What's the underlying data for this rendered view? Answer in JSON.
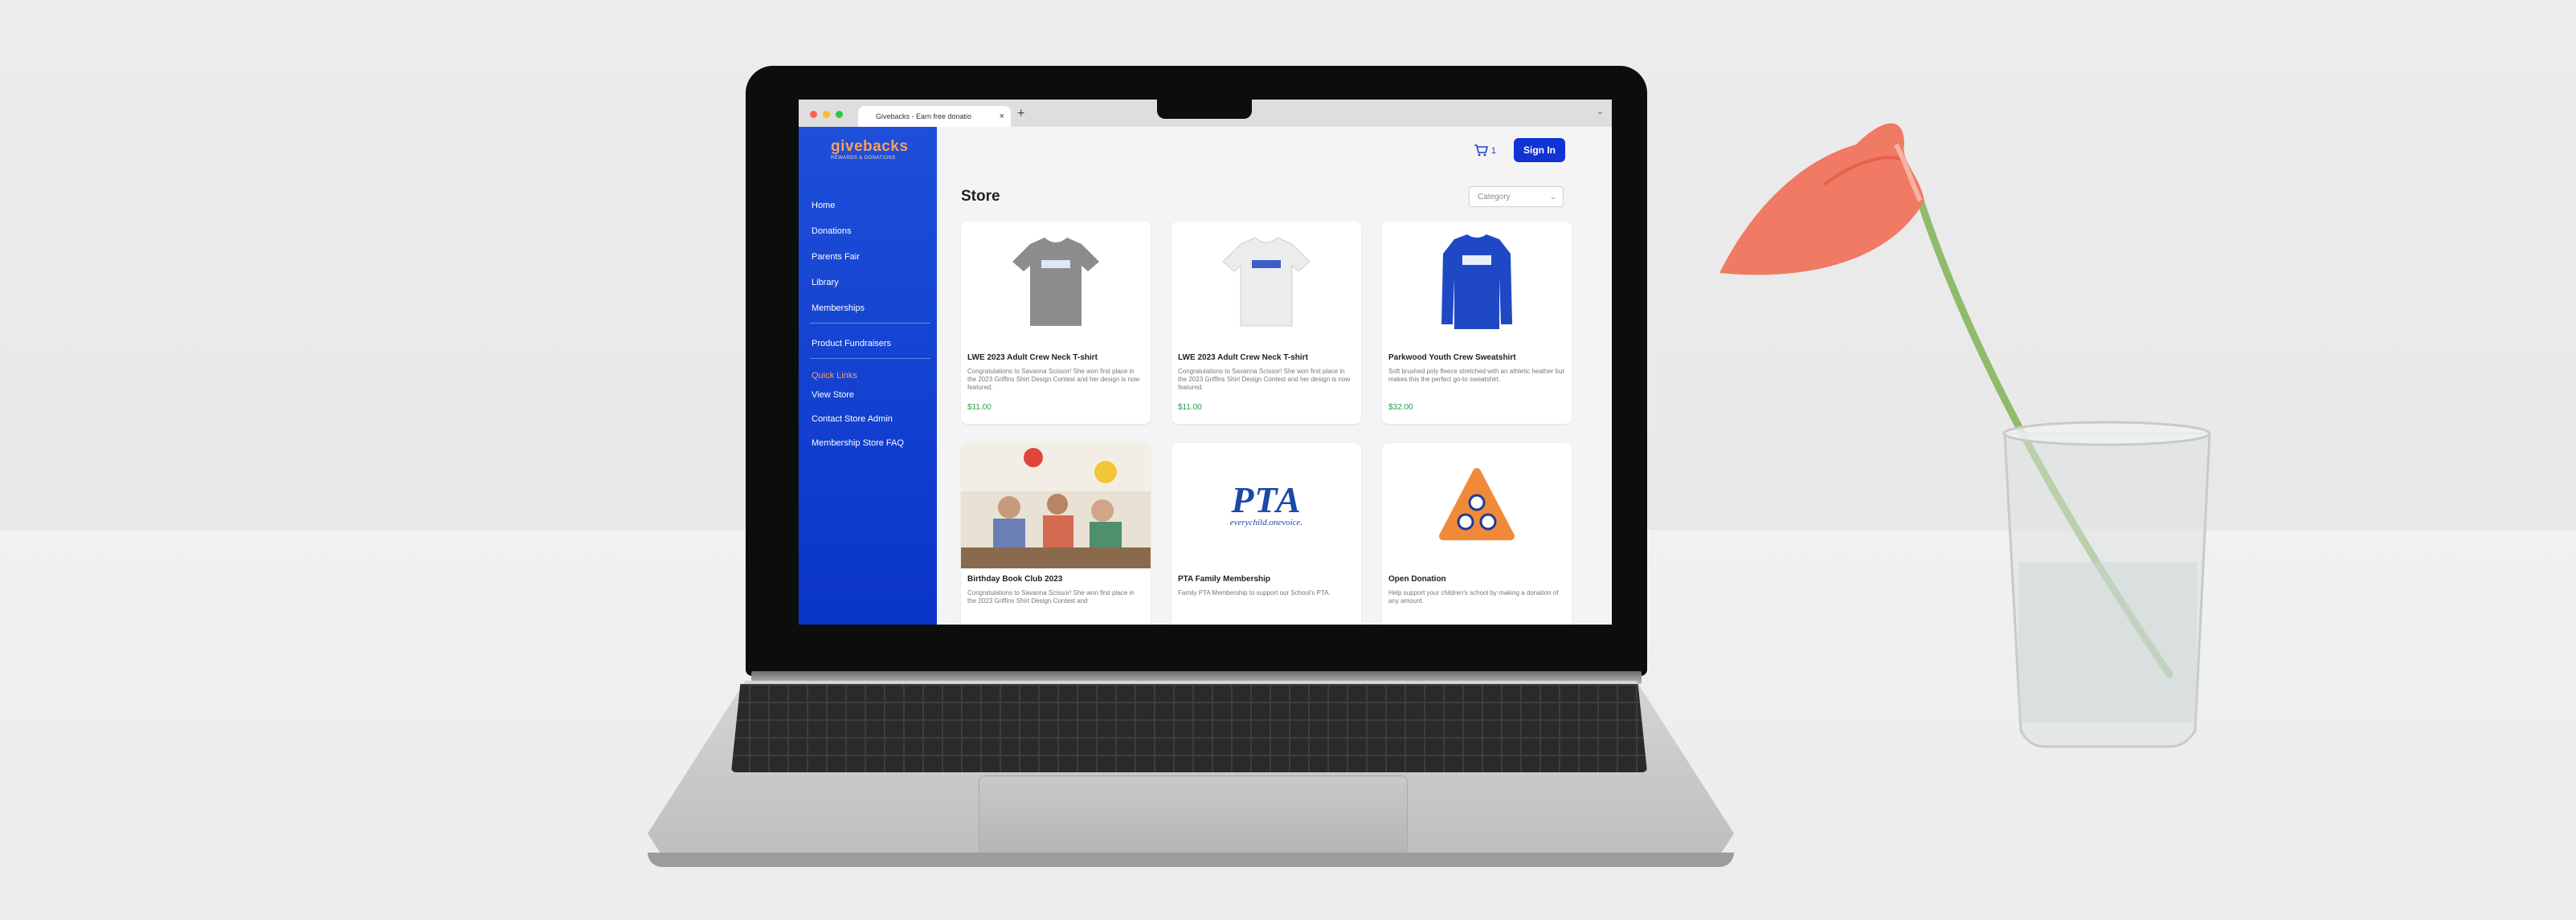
{
  "browser": {
    "tab_title": "Givebacks - Earn free donatio",
    "tab_close": "×",
    "new_tab": "+",
    "menu_chevron": "⌄"
  },
  "sidebar": {
    "logo": "givebacks",
    "logo_sub": "REWARDS & DONATIONS",
    "items": [
      {
        "label": "Home"
      },
      {
        "label": "Donations"
      },
      {
        "label": "Parents Fair"
      },
      {
        "label": "Library"
      },
      {
        "label": "Memberships"
      }
    ],
    "product_fundraisers": "Product Fundraisers",
    "quick_links_heading": "Quick Links",
    "quick_links": [
      {
        "label": "View Store"
      },
      {
        "label": "Contact Store Admin"
      },
      {
        "label": "Membership Store FAQ"
      }
    ]
  },
  "header": {
    "cart_count": "1",
    "signin_label": "Sign In"
  },
  "store": {
    "title": "Store",
    "category_label": "Category"
  },
  "products": [
    {
      "name": "LWE 2023 Adult Crew Neck T-shirt",
      "desc": "Congratulations to Savanna Scissor! She won first place in the 2023 Griffins Shirt Design Contest and her design is now featured.",
      "price": "$11.00"
    },
    {
      "name": "LWE 2023 Adult Crew Neck T-shirt",
      "desc": "Congratulations to Savanna Scissor! She won first place in the 2023 Griffins Shirt Design Contest and her design is now featured.",
      "price": "$11.00"
    },
    {
      "name": "Parkwood Youth Crew Sweatshirt",
      "desc": "Soft brushed poly fleece stretched with an athletic heather but makes this the perfect go-to sweatshirt.",
      "price": "$32.00"
    },
    {
      "name": "Birthday Book Club 2023",
      "desc": "Congratulations to Savanna Scissor! She won first place in the 2023 Griffins Shirt Design Contest and",
      "price": ""
    },
    {
      "name": "PTA Family Membership",
      "desc": "Family PTA Membership to support our School's PTA.",
      "price": ""
    },
    {
      "name": "Open Donation",
      "desc": "Help support your children's school by making a donation of any amount.",
      "price": ""
    }
  ],
  "pta_logo": {
    "text": "PTA",
    "tagline": "everychild.onevoice."
  },
  "colors": {
    "sidebar": "#1e4fd8",
    "accent": "#ff9d5c",
    "signin": "#1034d6",
    "price": "#2a9d47"
  },
  "icons": [
    "cart-icon",
    "chevron-down-icon",
    "close-icon",
    "plus-icon"
  ]
}
